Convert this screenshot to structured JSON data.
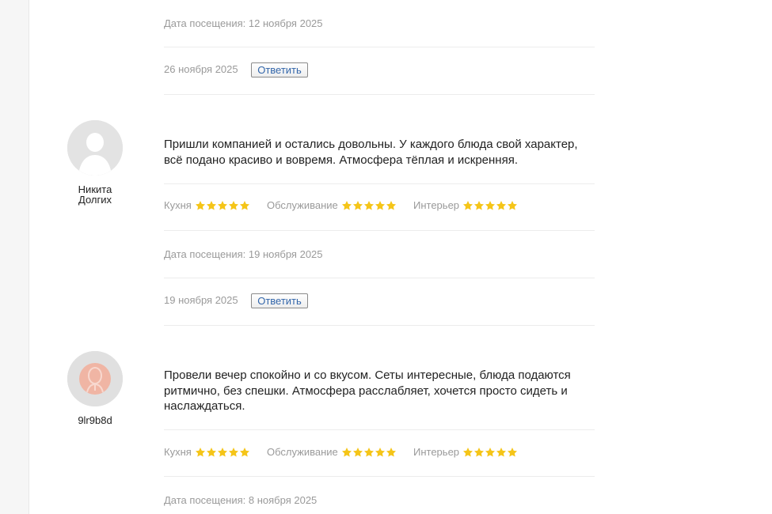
{
  "colors": {
    "star": "#f5c518",
    "reply_text": "#3366aa",
    "meta_text": "#9a9a9a"
  },
  "reply_label": "Ответить",
  "top_fragment": {
    "visit_date": "Дата посещения: 12 ноября 2025",
    "date": "26 ноября 2025"
  },
  "reviews": [
    {
      "author": [
        "Никита",
        "Долгих"
      ],
      "avatar": "default-user-avatar",
      "text": "Пришли компанией и остались довольны. У каждого блюда свой характер, всё подано красиво и вовремя. Атмосфера тёплая и искренняя.",
      "ratings": [
        {
          "label": "Кухня",
          "stars": 5
        },
        {
          "label": "Обслуживание",
          "stars": 5
        },
        {
          "label": "Интерьер",
          "stars": 5
        }
      ],
      "visit_date": "Дата посещения: 19 ноября 2025",
      "date": "19 ноября 2025"
    },
    {
      "author": [
        "9lr9b8d"
      ],
      "avatar": "generated-user-avatar",
      "text": "Провели вечер спокойно и со вкусом. Сеты интересные, блюда подаются ритмично, без спешки. Атмосфера расслабляет, хочется просто сидеть и наслаждаться.",
      "ratings": [
        {
          "label": "Кухня",
          "stars": 5
        },
        {
          "label": "Обслуживание",
          "stars": 5
        },
        {
          "label": "Интерьер",
          "stars": 5
        }
      ],
      "visit_date": "Дата посещения: 8 ноября 2025"
    }
  ]
}
